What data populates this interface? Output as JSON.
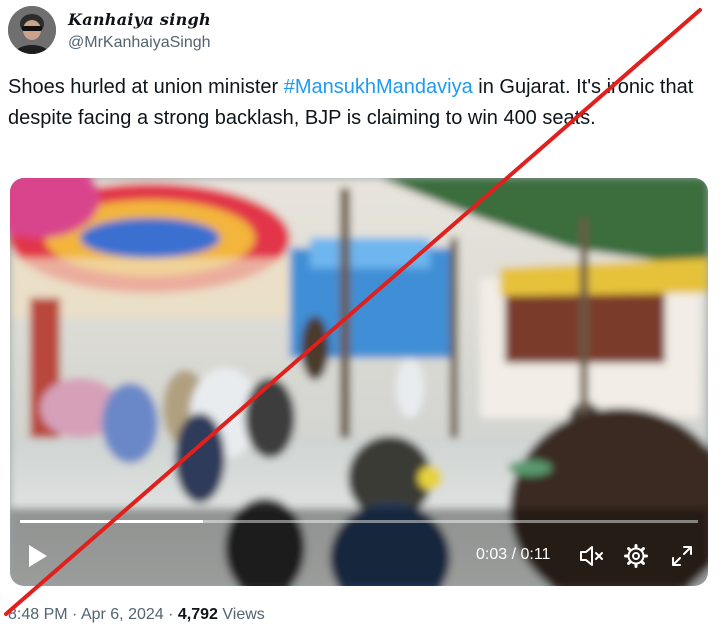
{
  "author": {
    "display_name": "Kanhaiya singh",
    "handle": "@MrKanhaiyaSingh"
  },
  "tweet": {
    "text_before": "Shoes hurled at union minister ",
    "hashtag": "#MansukhMandaviya",
    "text_after": " in Gujarat. It's ironic that despite facing a strong backlash, BJP is claiming  to win 400 seats."
  },
  "video": {
    "current_time": "0:03",
    "separator": " / ",
    "duration": "0:11",
    "progress_fraction": 0.27,
    "icons": {
      "play": "play-icon",
      "mute": "mute-icon",
      "settings": "gear-icon",
      "fullscreen": "fullscreen-icon"
    }
  },
  "meta": {
    "time": "8:48 PM",
    "sep1": " · ",
    "date": "Apr 6, 2024",
    "sep2": " · ",
    "views_count": "4,792",
    "views_label": " Views"
  },
  "colors": {
    "hashtag": "#1d9bf0",
    "cross_line": "#e0201c",
    "secondary_text": "#536471"
  }
}
